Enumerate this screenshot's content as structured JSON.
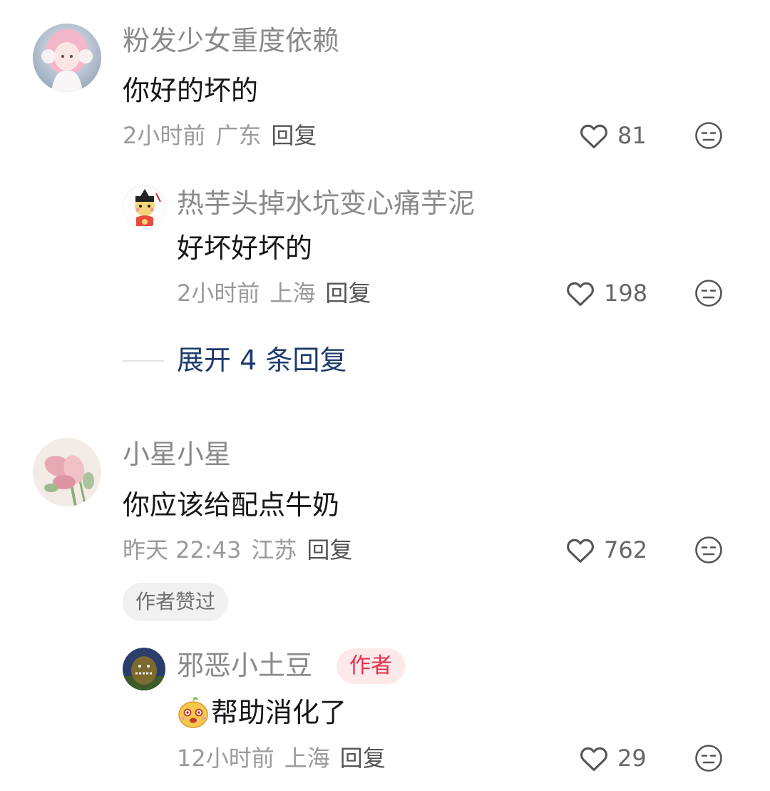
{
  "comments": [
    {
      "username": "粉发少女重度依赖",
      "text": "你好的坏的",
      "time": "2小时前",
      "location": "广东",
      "reply_label": "回复",
      "likes": "81",
      "replies": [
        {
          "username": "热芋头掉水坑变心痛芋泥",
          "text": "好坏好坏的",
          "time": "2小时前",
          "location": "上海",
          "reply_label": "回复",
          "likes": "198"
        }
      ],
      "expand_label": "展开 4 条回复"
    },
    {
      "username": "小星小星",
      "text": "你应该给配点牛奶",
      "time": "昨天 22:43",
      "location": "江苏",
      "reply_label": "回复",
      "likes": "762",
      "author_liked_tag": "作者赞过",
      "replies": [
        {
          "username": "邪恶小土豆",
          "author_tag": "作者",
          "text": "帮助消化了",
          "emoji": "potato-emoji",
          "time": "12小时前",
          "location": "上海",
          "reply_label": "回复",
          "likes": "29"
        }
      ]
    }
  ],
  "icons": {
    "like": "heart-outline-icon",
    "dislike": "neutral-face-icon"
  },
  "colors": {
    "username": "#8a8a8a",
    "text": "#161616",
    "meta": "#9a9a9a",
    "expand": "#1e3a6b",
    "author_tag_bg": "#fde8ea",
    "author_tag_fg": "#e3314b"
  }
}
